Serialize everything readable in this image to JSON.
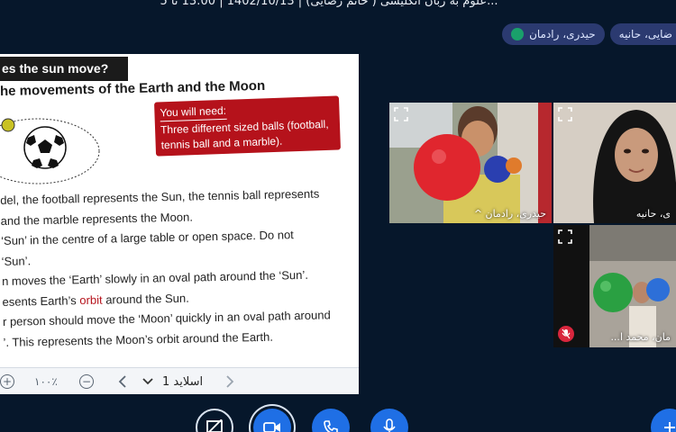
{
  "header": {
    "meeting_title": "علوم به زبان انگلیسی ( خانم رضایی) | 1402/10/13 | 13:00 تا 5..."
  },
  "chips": [
    {
      "label": "ضایی، حانیه"
    },
    {
      "label": "حیدری، رادمان"
    }
  ],
  "slide": {
    "heading": "es the sun move?",
    "subtitle": "he movements of the Earth and the Moon",
    "need_title": "You will need:",
    "need_body": "Three  different  sized  balls (football, tennis ball and a marble).",
    "lines": [
      "del, the football represents the Sun, the tennis ball represents",
      " and the marble represents the Moon.",
      "‘Sun’ in the centre of a large table or open space. Do not",
      "‘Sun’.",
      "n moves the ‘Earth’ slowly in an oval path around the ‘Sun’.",
      "r person should move the ‘Moon’ quickly in an oval path around",
      "’. This represents the Moon’s orbit around the Earth."
    ],
    "line_orbit_pre": "esents Earth’s ",
    "line_orbit_word": "orbit",
    "line_orbit_post": " around the Sun."
  },
  "toolbar": {
    "zoom": "۱۰۰٪",
    "slide_label": "اسلاید 1"
  },
  "videos": [
    {
      "name": "حیدری، رادمان"
    },
    {
      "name": "ی، حانیه"
    },
    {
      "name": "...مان، محمد ا"
    }
  ],
  "colors": {
    "background": "#06172b",
    "accent": "#1f6fe5",
    "mute": "#d9263d",
    "chip": "#2b3a70",
    "slide_red": "#b5121b"
  }
}
